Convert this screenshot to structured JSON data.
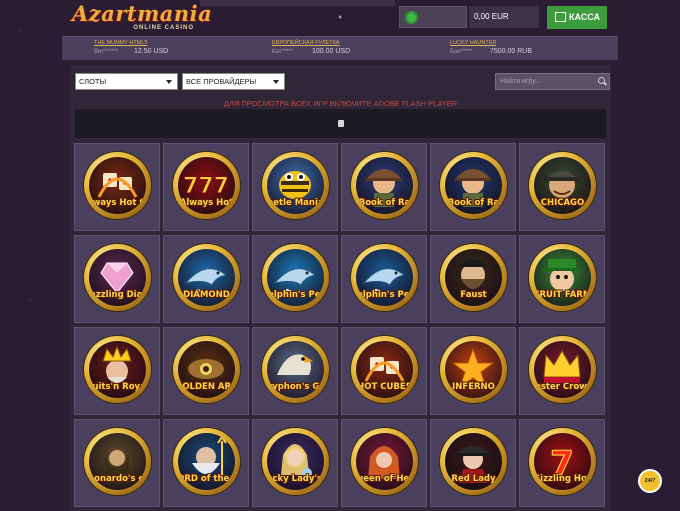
{
  "header": {
    "logo_main": "Azartmania",
    "logo_sub": "ONLINE CASINO",
    "balance": "0,00 EUR",
    "cash_label": "КАССА"
  },
  "winners": [
    {
      "game": "THE MUMMY HTML5",
      "user": "Вит******",
      "amount": "12.50 USD"
    },
    {
      "game": "ЕВРОПЕЙСКАЯ РУЛЕТКА",
      "user": "Кат*****",
      "amount": "100.00 USD"
    },
    {
      "game": "LUCKY HAUNTER",
      "user": "Бон*****",
      "amount": "7500.00 RUB"
    }
  ],
  "filters": {
    "category": "СЛОТЫ",
    "provider": "ВСЕ ПРОВАЙДЕРЫ",
    "search_placeholder": "Найти игру..."
  },
  "flash_message": "ДЛЯ ПРОСМОТРА ВСЕХ ИГР ВКЛЮЧИТЕ ADOBE FLASH PLAYER",
  "games": [
    {
      "label": "Always Hot Cubes",
      "bg": "#7a2a10",
      "icon": "dice"
    },
    {
      "label": "Always Hot",
      "bg": "#8a1010",
      "icon": "sevens"
    },
    {
      "label": "Beetle Mania Deluxe",
      "bg": "#3a6fb0",
      "icon": "bee"
    },
    {
      "label": "Book of Ra",
      "bg": "#2a3f7a",
      "icon": "explorer"
    },
    {
      "label": "Book of Ra",
      "bg": "#1e3a70",
      "icon": "explorer"
    },
    {
      "label": "CHICAGO",
      "bg": "#3a4a30",
      "icon": "gangster"
    },
    {
      "label": "Dazzling Diamonds",
      "bg": "#5a2850",
      "icon": "diamond"
    },
    {
      "label": "DIAMOND",
      "bg": "#1e68a8",
      "icon": "dolphin"
    },
    {
      "label": "Dolphin's Pearl",
      "bg": "#1a78b8",
      "icon": "dolphin"
    },
    {
      "label": "Dolphin's Pearl deluxe",
      "bg": "#1a5a9a",
      "icon": "dolphin"
    },
    {
      "label": "Faust",
      "bg": "#3a2a1a",
      "icon": "faust"
    },
    {
      "label": "FRUIT FARM",
      "bg": "#3a8a3a",
      "icon": "farmer"
    },
    {
      "label": "Fruits'n Royals",
      "bg": "#6a1a1a",
      "icon": "king"
    },
    {
      "label": "GOLDEN ARK",
      "bg": "#5a3010",
      "icon": "eye"
    },
    {
      "label": "Gryphon's Gold",
      "bg": "#5a6a8a",
      "icon": "gryphon"
    },
    {
      "label": "HOT CUBES",
      "bg": "#8a2a10",
      "icon": "dice"
    },
    {
      "label": "INFERNO",
      "bg": "#c04010",
      "icon": "star"
    },
    {
      "label": "Jester Crown",
      "bg": "#7a1a2a",
      "icon": "crown"
    },
    {
      "label": "Leonardo's code",
      "bg": "#5a4a2a",
      "icon": "mona"
    },
    {
      "label": "LORD of the OCEAN",
      "bg": "#1a4a7a",
      "icon": "poseidon"
    },
    {
      "label": "Lucky Lady's Charm",
      "bg": "#3a2a6a",
      "icon": "lady"
    },
    {
      "label": "Queen of Hearts",
      "bg": "#7a1a3a",
      "icon": "queen"
    },
    {
      "label": "Red Lady",
      "bg": "#3a1a1a",
      "icon": "redlady"
    },
    {
      "label": "Sizzling Hot",
      "bg": "#a01010",
      "icon": "seven"
    }
  ],
  "chat_badge": "24/7"
}
